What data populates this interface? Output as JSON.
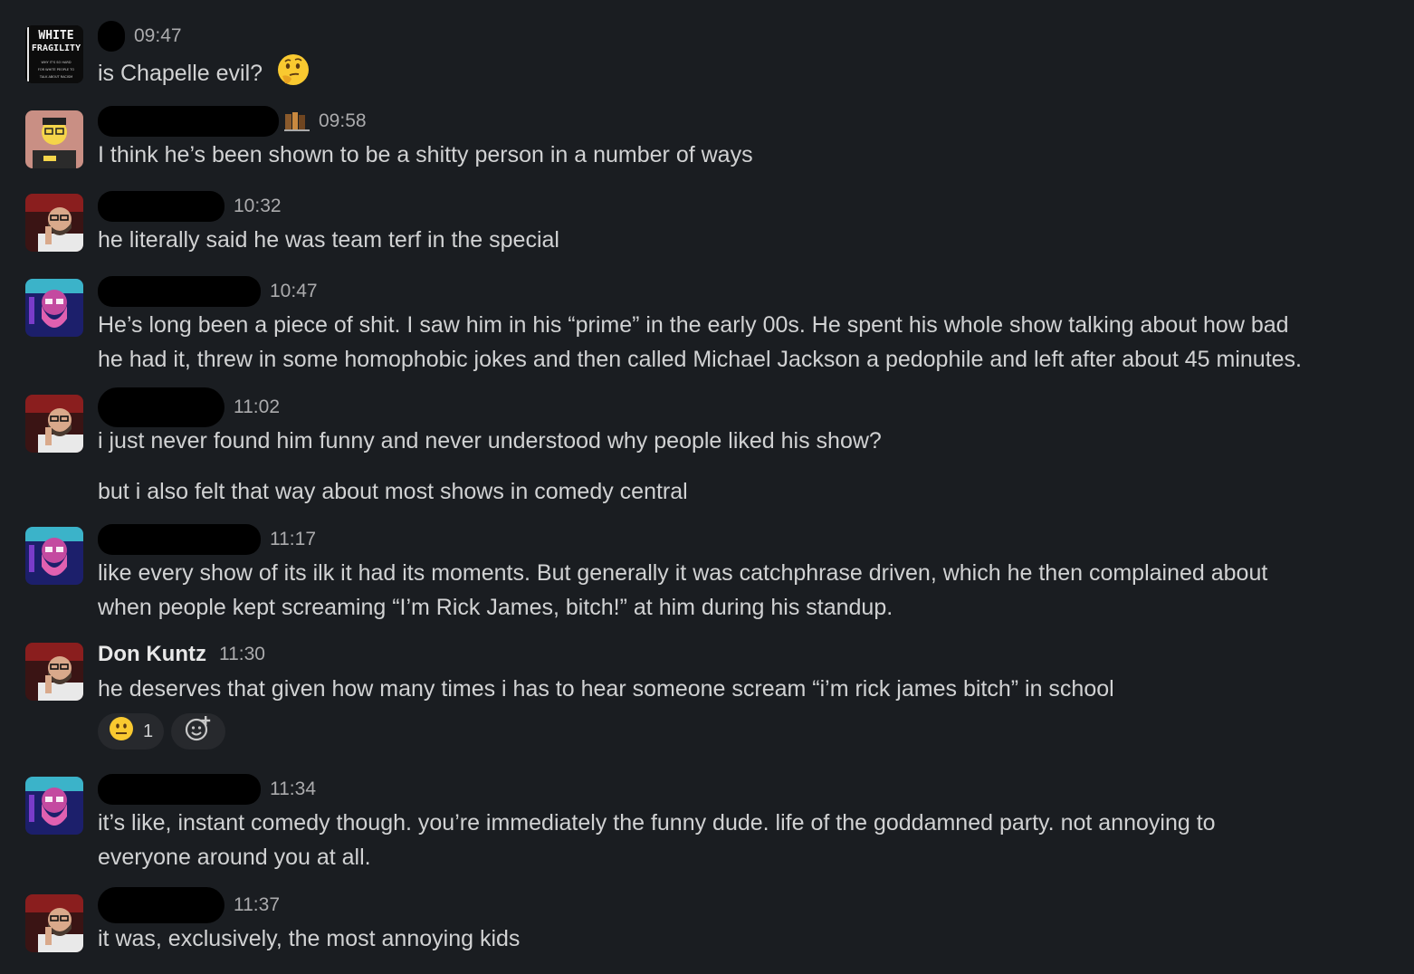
{
  "messages": [
    {
      "avatar": "white-fragility-book-avatar",
      "author": "",
      "time": "09:47",
      "lines": [
        "is Chapelle evil?"
      ],
      "trailing_emoji": "thinking-face-emoji"
    },
    {
      "avatar": "cartoon-man-avatar",
      "author": "",
      "time": "09:58",
      "lines": [
        "I think he’s been shown to be a shitty person in a number of ways"
      ],
      "status_icon": "books-icon"
    },
    {
      "avatar": "bearded-man-red-avatar",
      "author": "",
      "time": "10:32",
      "lines": [
        "he literally said he was team terf in the special"
      ]
    },
    {
      "avatar": "neon-bearded-man-avatar",
      "author": "",
      "time": "10:47",
      "lines": [
        "He’s long been a piece of shit. I saw him in his “prime” in the early 00s. He spent his whole show talking about how bad",
        "he had it, threw in some homophobic jokes and then called Michael Jackson a pedophile and left after about 45 minutes."
      ]
    },
    {
      "avatar": "bearded-man-red-avatar",
      "author": "",
      "time": "11:02",
      "lines": [
        "i just never found him funny and never understood why people liked his show?"
      ]
    },
    {
      "avatar": "",
      "author": "",
      "time": "",
      "lines": [
        "but i also felt that way about most shows in comedy central"
      ]
    },
    {
      "avatar": "neon-bearded-man-avatar",
      "author": "",
      "time": "11:17",
      "lines": [
        "like every show of its ilk it had its moments. But generally it was catchphrase driven, which he then complained about",
        "when people kept screaming “I’m Rick James, bitch!” at him during his standup."
      ]
    },
    {
      "avatar": "bearded-man-red-avatar",
      "author": "Don Kuntz",
      "time": "11:30",
      "lines": [
        "he deserves that given how many times i has to hear someone scream “i’m rick james bitch” in school"
      ]
    },
    {
      "avatar": "neon-bearded-man-avatar",
      "author": "",
      "time": "11:34",
      "lines": [
        "it’s like, instant comedy though. you’re immediately the funny dude. life of the goddamned party. not annoying to",
        "everyone around you at all."
      ]
    },
    {
      "avatar": "bearded-man-red-avatar",
      "author": "",
      "time": "11:37",
      "lines": [
        "it was, exclusively, the most annoying kids"
      ]
    }
  ],
  "reaction": {
    "emoji": "neutral-face-emoji",
    "count": "1",
    "add_icon": "add-reaction-icon"
  },
  "book_cover": {
    "title1": "WHITE",
    "title2": "FRAGILITY",
    "sub1": "WHY IT'S SO HARD",
    "sub2": "FOR WHITE PEOPLE TO",
    "sub3": "TALK ABOUT RACISM"
  },
  "colors": {
    "background": "#1a1d21",
    "text": "#d1d2d3",
    "timestamp": "#ababad",
    "pill": "#27292d"
  }
}
